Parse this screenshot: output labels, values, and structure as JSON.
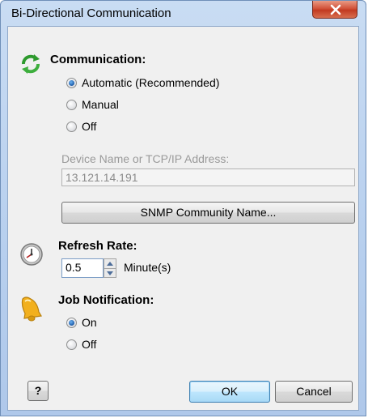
{
  "window": {
    "title": "Bi-Directional Communication"
  },
  "communication": {
    "title": "Communication:",
    "options": [
      {
        "label": "Automatic (Recommended)",
        "checked": true
      },
      {
        "label": "Manual",
        "checked": false
      },
      {
        "label": "Off",
        "checked": false
      }
    ],
    "device_label": "Device Name or TCP/IP Address:",
    "device_value": "13.121.14.191",
    "snmp_button": "SNMP Community Name..."
  },
  "refresh": {
    "title": "Refresh Rate:",
    "value": "0.5",
    "unit": "Minute(s)"
  },
  "job": {
    "title": "Job Notification:",
    "options": [
      {
        "label": "On",
        "checked": true
      },
      {
        "label": "Off",
        "checked": false
      }
    ]
  },
  "buttons": {
    "help": "?",
    "ok": "OK",
    "cancel": "Cancel"
  },
  "colors": {
    "accent": "#3c7fb1",
    "sync_icon": "#2e9a2e",
    "bell": "#f2b01e"
  }
}
